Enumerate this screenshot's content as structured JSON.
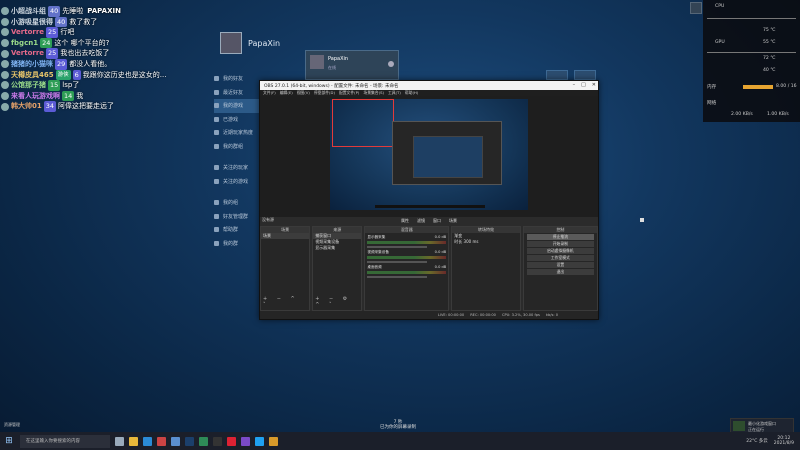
{
  "chat": [
    {
      "name": "小超战斗组",
      "level": "40",
      "message": "先睡啦",
      "level_style": "dim",
      "extra": "PAPAXIN",
      "name_color": "#cfd8e0"
    },
    {
      "name": "小游吸星很得",
      "level": "40",
      "message": "救了救了",
      "level_style": "dim",
      "name_color": "#cfd8e0"
    },
    {
      "name": "Vertorre",
      "level": "25",
      "message": "行吧",
      "level_style": "",
      "name_color": "#e86a8a"
    },
    {
      "name": "fbgcn1",
      "level": "24",
      "message": "这个 哪个平台的?",
      "level_style": "green",
      "name_color": "#9bdc8a"
    },
    {
      "name": "Vertorre",
      "level": "25",
      "message": "我也出去吃饭了",
      "level_style": "",
      "name_color": "#e86a8a"
    },
    {
      "name": "猪猪的小猫咪",
      "level": "29",
      "message": "都没人看他。",
      "level_style": "",
      "name_color": "#7fb2f0"
    },
    {
      "name": "天樽皮具465",
      "tag": "游侠",
      "level": "6",
      "message": "我跟你这历史也是这女的...",
      "level_style": "",
      "name_color": "#e8c56a"
    },
    {
      "name": "公馆那子猪",
      "level": "15",
      "message": "lsp了",
      "level_style": "green",
      "name_color": "#9bdc8a"
    },
    {
      "name": "来看人玩游戏啊",
      "level": "14",
      "message": "我",
      "level_style": "green",
      "name_color": "#c97ae8"
    },
    {
      "name": "韩大帅01",
      "level": "34",
      "message": "阿偉这把要走远了",
      "level_style": "",
      "name_color": "#e8a36a"
    }
  ],
  "profile": {
    "name": "PapaXin"
  },
  "left_nav": {
    "items": [
      "我的好友",
      "最近好友",
      "我的游戏",
      "已游戏",
      "近期玩家热度",
      "我的群组",
      "关注的玩家",
      "关注的游戏",
      "我的组",
      "好友管理群",
      "帮助群",
      "我的群"
    ],
    "selected_index": 2
  },
  "popup_card": {
    "title": "PapaXin",
    "subtitle": "在线"
  },
  "obs": {
    "title": "OBS 27.0.1 (64-bit, windows) - 配置文件: 未命名 - 场景: 未命名",
    "menu": [
      "文件(F)",
      "编辑(E)",
      "视图(V)",
      "停靠部件(D)",
      "配置文件(P)",
      "场景集合(S)",
      "工具(T)",
      "帮助(H)"
    ],
    "window_controls": [
      "–",
      "□",
      "✕"
    ],
    "toolbar": [
      "属性",
      "滤镜",
      "窗口",
      "场景"
    ],
    "scene_label": "没有源",
    "docks": {
      "scenes": {
        "header": "场景",
        "items": [
          "场景"
        ]
      },
      "sources": {
        "header": "来源",
        "items": [
          "捕获窗口",
          "视频采集设备",
          "显示器采集"
        ]
      },
      "mixer": {
        "header": "混音器",
        "channels": [
          {
            "name": "显示器采集",
            "db": "0.0 dB"
          },
          {
            "name": "视频采集设备",
            "db": "0.0 dB"
          },
          {
            "name": "桌面音频",
            "db": "0.0 dB"
          }
        ]
      },
      "transitions": {
        "header": "转场特效",
        "type": "渐变",
        "duration_label": "时长",
        "duration": "300 ms"
      },
      "controls": {
        "header": "控制",
        "buttons": [
          "停止推流",
          "开始录制",
          "启动虚拟摄像机",
          "工作室模式",
          "设置",
          "退出"
        ]
      }
    },
    "status": [
      "LIVE: 00:00:00",
      "REC: 00:00:00",
      "CPU: 3.2%, 30.00 fps",
      "kb/s: 0"
    ]
  },
  "monitor": {
    "cpu_label": "CPU",
    "cpu_temp": "75 ℃",
    "cpu_temp2": "55 ℃",
    "gpu_label": "GPU",
    "gpu_temp": "72 ℃",
    "gpu_temp2": "40 ℃",
    "ram_label": "内存",
    "ram_value": "8.00 / 16",
    "net_label": "网络",
    "net_down": "2.00 KB/s",
    "net_up": "1.00 KB/s",
    "ram_fraction": 0.5
  },
  "taskbar": {
    "search_placeholder": "在这里输入你要搜索的内容",
    "time": "20:12",
    "date": "2021/8/9",
    "weather": "22°C 多云",
    "icons": [
      {
        "name": "task-view-icon",
        "color": "#9ab"
      },
      {
        "name": "file-explorer-icon",
        "color": "#e8b83a"
      },
      {
        "name": "edge-icon",
        "color": "#2b8bd6"
      },
      {
        "name": "game-icon",
        "color": "#c44"
      },
      {
        "name": "store-icon",
        "color": "#5a8fd0"
      },
      {
        "name": "steam-icon",
        "color": "#1b3f6b"
      },
      {
        "name": "app-icon",
        "color": "#2e8b57"
      },
      {
        "name": "obs-icon",
        "color": "#333"
      },
      {
        "name": "music-icon",
        "color": "#d23"
      },
      {
        "name": "media-icon",
        "color": "#7a4ac8"
      },
      {
        "name": "chat-icon",
        "color": "#1fa1f1"
      },
      {
        "name": "folder-icon",
        "color": "#d89a2a"
      }
    ]
  },
  "notification": {
    "title": "最小化游戏窗口",
    "subtitle": "正在运行"
  },
  "bottom_left": {
    "label": "资源管理"
  },
  "center_note": {
    "line1": "7 秒",
    "line2": "已为你的屏幕录制"
  },
  "colors": {
    "desktop": "#12375f",
    "accent": "#2c5a88",
    "live_red": "#e23a3a"
  }
}
